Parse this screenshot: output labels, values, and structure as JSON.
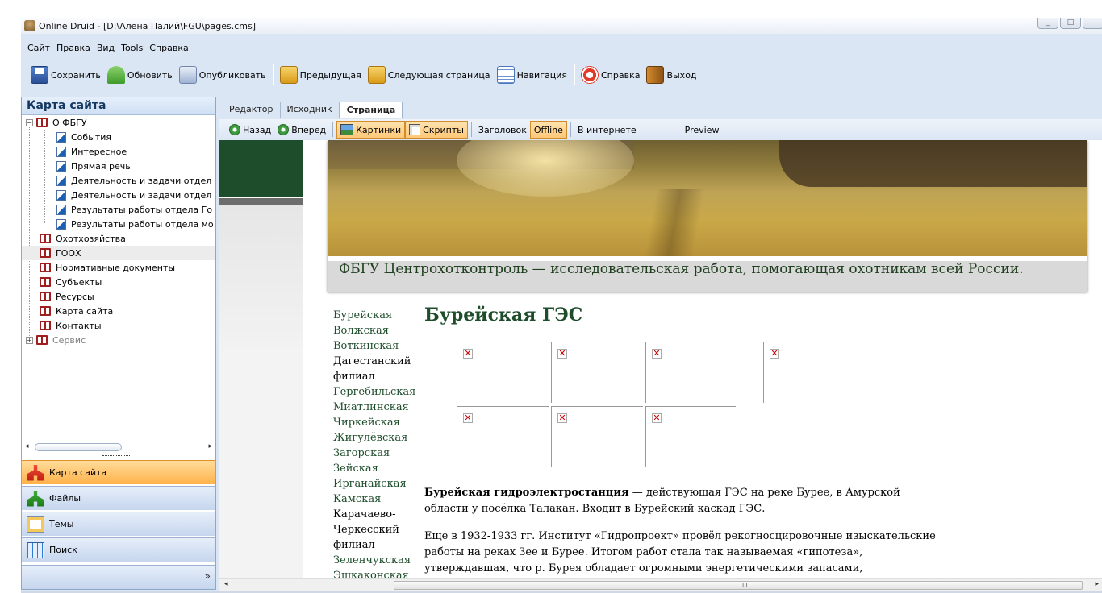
{
  "window": {
    "title": "Online Druid - [D:\\Алена Палий\\FGU\\pages.cms]"
  },
  "menu": [
    "Сайт",
    "Правка",
    "Вид",
    "Tools",
    "Справка"
  ],
  "toolbar": {
    "save": "Сохранить",
    "update": "Обновить",
    "publish": "Опубликовать",
    "prev": "Предыдущая",
    "next": "Следующая страница",
    "nav": "Навигация",
    "help": "Справка",
    "exit": "Выход"
  },
  "sidebar": {
    "header": "Карта сайта",
    "tree": [
      {
        "label": "О ФБГУ",
        "type": "book",
        "expanded": true
      },
      {
        "label": "События",
        "type": "page"
      },
      {
        "label": "Интересное",
        "type": "page"
      },
      {
        "label": "Прямая речь",
        "type": "page"
      },
      {
        "label": "Деятельность и задачи отдел",
        "type": "page"
      },
      {
        "label": "Деятельность и задачи отдел",
        "type": "page"
      },
      {
        "label": "Результаты работы отдела Го",
        "type": "page"
      },
      {
        "label": "Результаты работы отдела мо",
        "type": "page"
      },
      {
        "label": "Охотхозяйства",
        "type": "book"
      },
      {
        "label": "ГООХ",
        "type": "book",
        "selected": true
      },
      {
        "label": "Нормативные документы",
        "type": "book"
      },
      {
        "label": "Субъекты",
        "type": "book"
      },
      {
        "label": "Ресурсы",
        "type": "book"
      },
      {
        "label": "Карта сайта",
        "type": "book"
      },
      {
        "label": "Контакты",
        "type": "book"
      },
      {
        "label": "Сервис",
        "type": "book",
        "collapsed": true,
        "disabled": true
      }
    ],
    "nav_buttons": [
      {
        "label": "Карта сайта",
        "active": true
      },
      {
        "label": "Файлы"
      },
      {
        "label": "Темы"
      },
      {
        "label": "Поиск"
      }
    ]
  },
  "editor": {
    "tabs": [
      "Редактор",
      "Исходник",
      "Страница"
    ],
    "active_tab": "Страница",
    "view": {
      "back": "Назад",
      "forward": "Вперед",
      "pictures": "Картинки",
      "scripts": "Скрипты",
      "header": "Заголовок",
      "offline": "Offline",
      "online": "В интернете",
      "preview": "Preview"
    }
  },
  "page": {
    "banner_text": "ФБГУ Центрохотконтроль — исследовательская работа, помогающая охотникам всей России.",
    "sidelinks": [
      "Бурейская",
      "Волжская",
      "Воткинская",
      "Дагестанский",
      "филиал",
      "Гергебильская",
      "Миатлинская",
      "Чиркейская",
      "Жигулёвская",
      "Загорская",
      "Зейская",
      "Ирганайская",
      "Камская",
      "Карачаево-",
      "Черкесский",
      "филиал",
      "Зеленчукская",
      "Эшкаконская"
    ],
    "heading": "Бурейская ГЭС",
    "p1_bold": "Бурейская гидроэлектростанция",
    "p1_rest": " — действующая ГЭС на реке Бурее, в Амурской области у посёлка Талакан. Входит в Бурейский каскад ГЭС.",
    "p2": "Еще в 1932-1933 гг. Институт «Гидропроект» провёл рекогносцировочные изыскательские работы на реках Зее и Бурее. Итогом работ стала так называемая «гипотеза», утверждавшая, что р. Бурея обладает огромными энергетическими запасами,"
  },
  "icons": {
    "broken_image": "✕",
    "grip": "ııı"
  }
}
